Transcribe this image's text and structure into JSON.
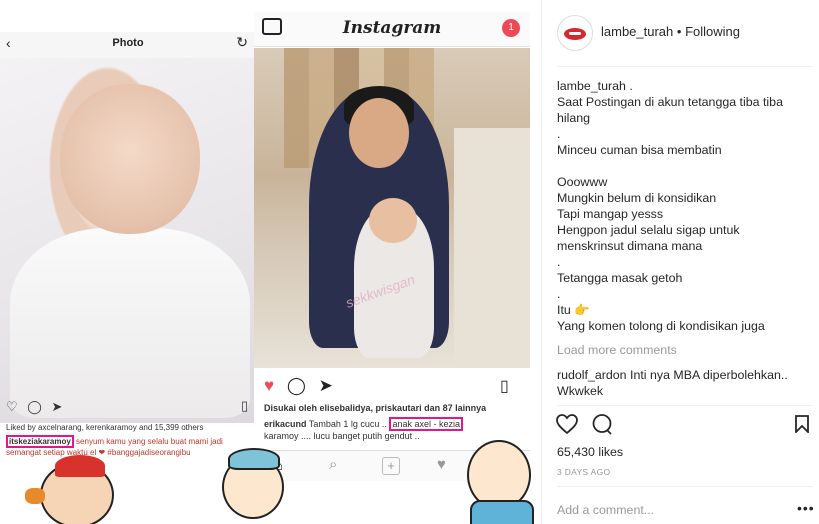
{
  "left_phone": {
    "title": "Photo",
    "back_icon": "chevron-left-icon",
    "reload_icon": "reload-icon",
    "likes": "Liked by axcelnarang, kerenkaramoy and 15,399 others",
    "caption_user": "itskeziakaramoy",
    "caption_text": " senyum kamu yang selalu buat mami jadi semangat setiap waktu el ❤ #banggajadiseorangibu"
  },
  "right_phone": {
    "app_title": "Instagram",
    "notification_count": "1",
    "likes": "Disukai oleh elisebalidya, priskautari dan 87 lainnya",
    "caption_user": "erikacund",
    "caption_text": "Tambah 1 lg cucu ..",
    "caption_highlight": "anak axel - kezia",
    "caption_rest": "karamoy .... lucu banget putih gendut ..",
    "watermark": "sekkwisgan"
  },
  "post": {
    "username": "lambe_turah",
    "following": "Following",
    "caption_lines": "lambe_turah .\nSaat Postingan di akun tetangga tiba tiba\nhilang\n.\nMinceu cuman bisa membatin\n\nOoowww\nMungkin belum di konsidikan\nTapi mangap yesss\nHengpon jadul selalu sigap untuk\nmenskrinsut dimana mana\n.\nTetangga masak getoh\n.\nItu 👉\nYang komen tolong di kondisikan juga",
    "load_more": "Load more comments",
    "comment_user": "rudolf_ardon",
    "comment_text": "Inti nya MBA diperbolehkan.. Wkwkek",
    "likes": "65,430 likes",
    "time_ago": "3 DAYS AGO",
    "add_comment_placeholder": "Add a comment...",
    "more_icon": "•••"
  },
  "colors": {
    "highlight": "#e2178e",
    "heart": "#ed4956",
    "text": "#262626",
    "muted": "#999999"
  }
}
